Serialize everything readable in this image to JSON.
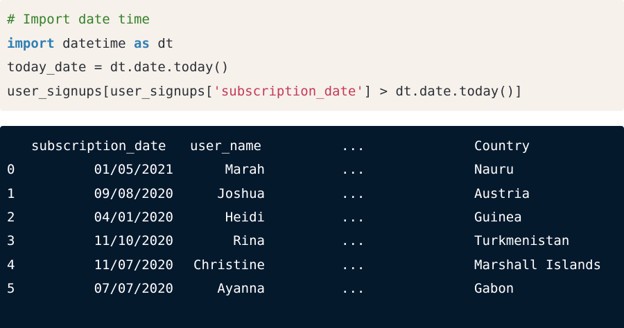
{
  "code": {
    "comment": "# Import date time",
    "line2": {
      "kw1": "import",
      "mod": " datetime ",
      "kw2": "as",
      "alias": " dt"
    },
    "line3": "today_date = dt.date.today()",
    "line4": {
      "pre": "user_signups[user_signups[",
      "str": "'subscription_date'",
      "post": "] > dt.date.today()]"
    }
  },
  "output": {
    "headers": {
      "col1": "subscription_date",
      "col2": "user_name",
      "col3": "...",
      "col4": "Country"
    },
    "rows": [
      {
        "idx": "0",
        "date": "01/05/2021",
        "name": "Marah",
        "dots": "...",
        "country": "Nauru"
      },
      {
        "idx": "1",
        "date": "09/08/2020",
        "name": "Joshua",
        "dots": "...",
        "country": "Austria"
      },
      {
        "idx": "2",
        "date": "04/01/2020",
        "name": "Heidi",
        "dots": "...",
        "country": "Guinea"
      },
      {
        "idx": "3",
        "date": "11/10/2020",
        "name": "Rina",
        "dots": "...",
        "country": "Turkmenistan"
      },
      {
        "idx": "4",
        "date": "11/07/2020",
        "name": "Christine",
        "dots": "...",
        "country": "Marshall Islands"
      },
      {
        "idx": "5",
        "date": "07/07/2020",
        "name": "Ayanna",
        "dots": "...",
        "country": "Gabon"
      }
    ]
  },
  "colors": {
    "code_bg": "#f6f1ea",
    "output_bg": "#05192d",
    "comment": "#35802a",
    "keyword": "#2f7fb5",
    "string": "#c4395c"
  }
}
